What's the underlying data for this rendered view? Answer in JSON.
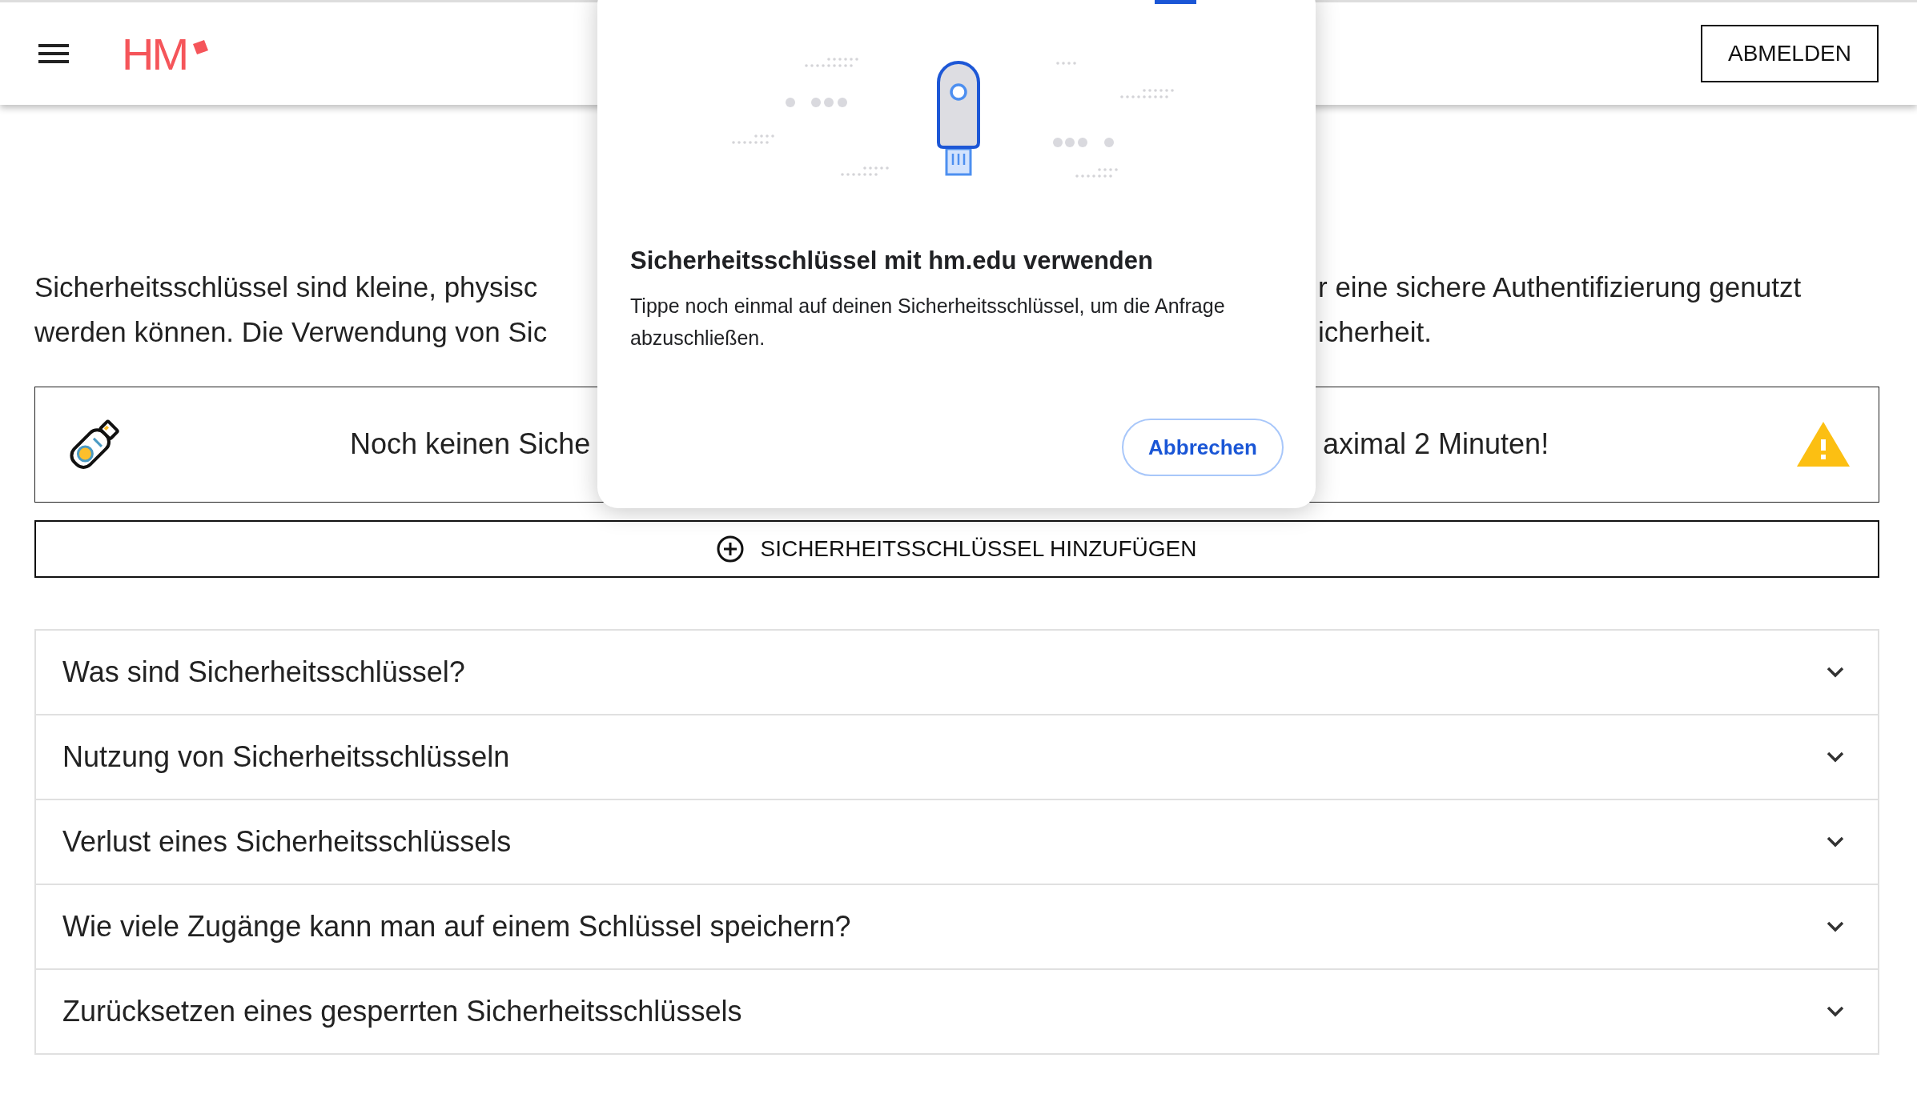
{
  "header": {
    "logo": "HM",
    "logout_button": "ABMELDEN"
  },
  "intro": {
    "lines": [
      {
        "left": "Sicherheitsschlüssel sind kleine, physisc",
        "right": "r eine sichere Authentifizierung genutzt"
      },
      {
        "left": "werden können. Die Verwendung von Sic",
        "right": "icherheit."
      }
    ]
  },
  "notice": {
    "left": "Noch keinen Siche",
    "right": "aximal 2 Minuten!"
  },
  "add_button": "SICHERHEITSSCHLÜSSEL HINZUFÜGEN",
  "faq": [
    {
      "question": "Was sind Sicherheitsschlüssel?",
      "expanded": false
    },
    {
      "question": "Nutzung von Sicherheitsschlüsseln",
      "expanded": false
    },
    {
      "question": "Verlust eines Sicherheitsschlüssels",
      "expanded": false
    },
    {
      "question": "Wie viele Zugänge kann man auf einem Schlüssel speichern?",
      "expanded": false
    },
    {
      "question": "Zurücksetzen eines gesperrten Sicherheitsschlüssels",
      "expanded": false
    }
  ],
  "dialog": {
    "title": "Sicherheitsschlüssel mit hm.edu verwenden",
    "body": "Tippe noch einmal auf deinen Sicherheitsschlüssel, um die Anfrage abzuschließen.",
    "cancel_button": "Abbrechen"
  }
}
